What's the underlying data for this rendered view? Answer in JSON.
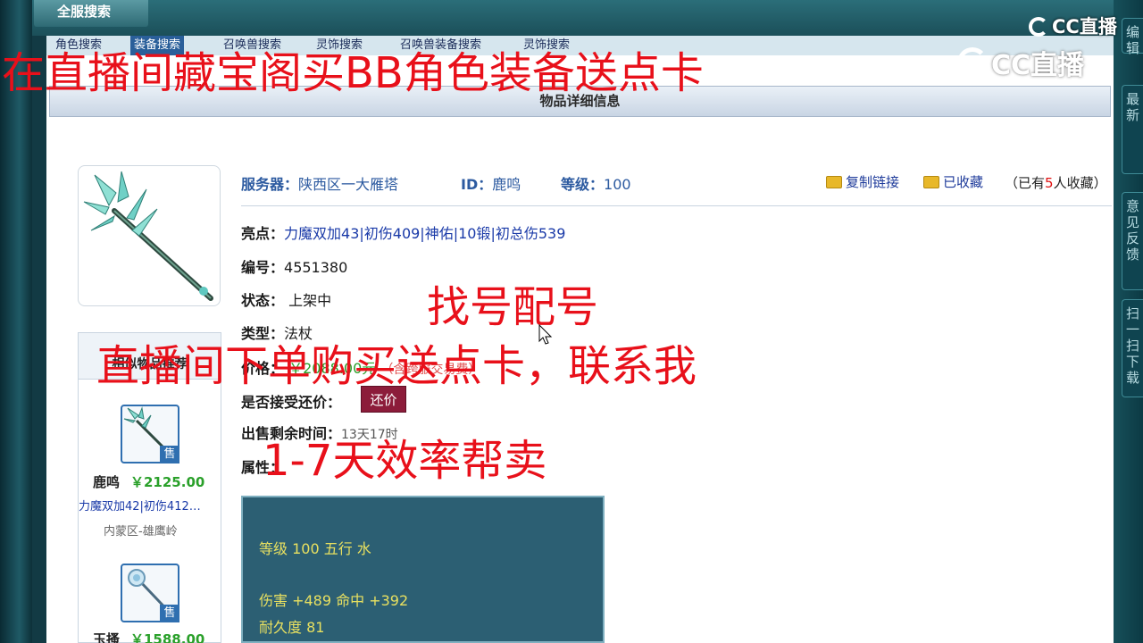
{
  "top_tab": "全服搜索",
  "sub_tabs": [
    "角色搜索",
    "装备搜索",
    "召唤兽搜索",
    "灵饰搜索",
    "召唤兽装备搜索",
    "灵饰搜索"
  ],
  "detail_header": "物品详细信息",
  "item": {
    "server_label": "服务器：",
    "server_value": "陕西区一大雁塔",
    "id_label": "ID：",
    "id_value": "鹿鸣",
    "level_label": "等级：",
    "level_value": "100",
    "highlights_label": "亮点：",
    "highlights_value": "力魔双加43|初伤409|神佑|10锻|初总伤539",
    "number_label": "编号：",
    "number_value": "4551380",
    "status_label": "状态：",
    "status_value": "上架中",
    "type_label": "类型：",
    "type_value": "法杖",
    "price_label": "价格：",
    "price_value": "￥2088.00元",
    "price_note": "（含跨服交易费）",
    "counter_label": "是否接受还价：",
    "counter_button": "还价",
    "remaining_label": "出售剩余时间：",
    "remaining_value": "13天17时",
    "attr_label": "属性："
  },
  "actions": {
    "copy_link": "复制链接",
    "collected": "已收藏",
    "collect_prefix": "（已有",
    "collect_count": "5",
    "collect_suffix": "人收藏）"
  },
  "side": {
    "title": "相似物品推荐",
    "items": [
      {
        "name": "鹿鸣",
        "price": "￥2125.00",
        "desc": "力魔双加42|初伤412…",
        "server": "内蒙区-雄鹰岭",
        "badge": "售"
      },
      {
        "name": "玉搔",
        "price": "￥1588.00",
        "badge": "售"
      }
    ]
  },
  "attributes": {
    "line1": "等级 100 五行 水",
    "line2": "伤害 +489 命中 +392",
    "line3": "耐久度 81"
  },
  "right_tabs": [
    "编辑",
    "最新",
    "意见反馈",
    "扫一扫下载"
  ],
  "overlay": {
    "banner": "在直播间藏宝阁买BB角色装备送点卡",
    "line1": "找号配号",
    "line2": "直播间下单购买送点卡，联系我",
    "line3": "1-7天效率帮卖"
  },
  "logo": {
    "small": "CC直播",
    "big": "CC直播"
  },
  "colors": {
    "overlay_red": "#e8101a",
    "link_blue": "#1a3aa8",
    "price_green": "#2aa02a",
    "counter_button": "#8c1c3a"
  }
}
